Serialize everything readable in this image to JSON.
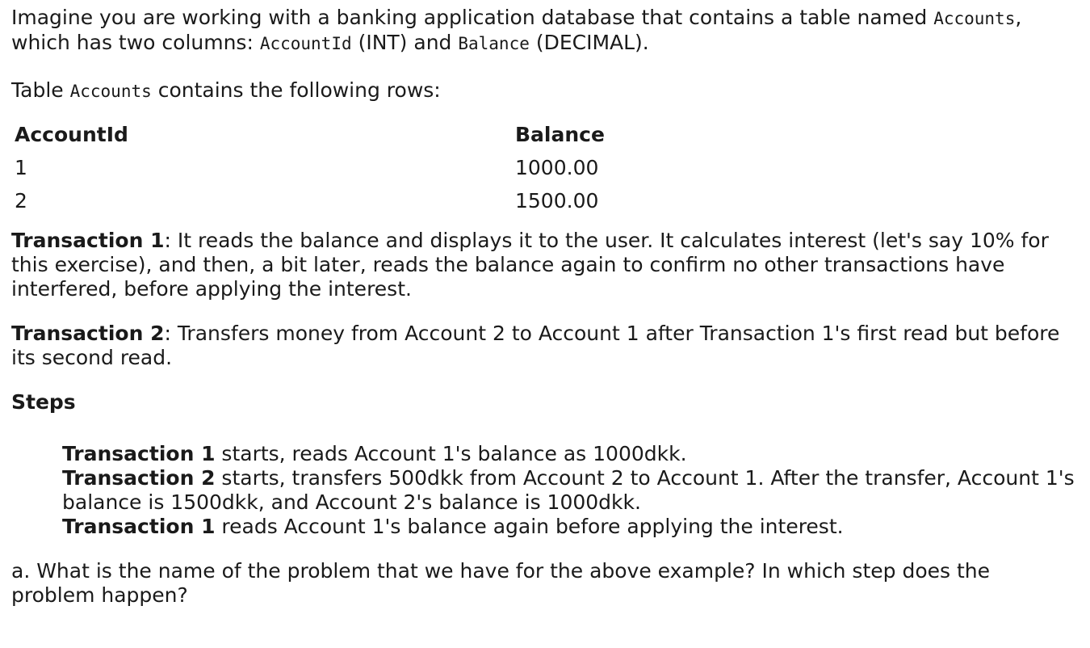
{
  "intro": {
    "t1": "Imagine you are working with a banking application database that contains a table named ",
    "code1": "Accounts",
    "t2": ", which has two columns: ",
    "code2": "AccountId",
    "t3": " (INT) and ",
    "code3": "Balance",
    "t4": " (DECIMAL)."
  },
  "table_intro": {
    "t1": "Table ",
    "code": "Accounts",
    "t2": " contains the following rows:"
  },
  "table": {
    "headers": [
      "AccountId",
      "Balance"
    ],
    "rows": [
      [
        "1",
        "1000.00"
      ],
      [
        "2",
        "1500.00"
      ]
    ]
  },
  "transaction1": {
    "label": "Transaction 1",
    "text": ": It reads the balance and displays it to the user. It calculates interest (let's say 10% for this exercise), and then, a bit later, reads the balance again to confirm no other transactions have interfered, before applying the interest."
  },
  "transaction2": {
    "label": "Transaction 2",
    "text": ": Transfers money from Account 2 to Account 1 after Transaction 1's first read but before its second read."
  },
  "steps": {
    "heading": "Steps",
    "items": [
      {
        "label": "Transaction 1",
        "text": " starts, reads Account 1's balance as 1000dkk."
      },
      {
        "label": "Transaction 2",
        "text": " starts, transfers 500dkk from Account 2 to Account 1. After the transfer, Account 1's balance is 1500dkk, and Account 2's balance is 1000dkk."
      },
      {
        "label": "Transaction 1",
        "text": " reads Account 1's balance again before applying the interest."
      }
    ]
  },
  "question": "a. What is the name of the problem that we have for the above example? In which step does the problem happen?"
}
